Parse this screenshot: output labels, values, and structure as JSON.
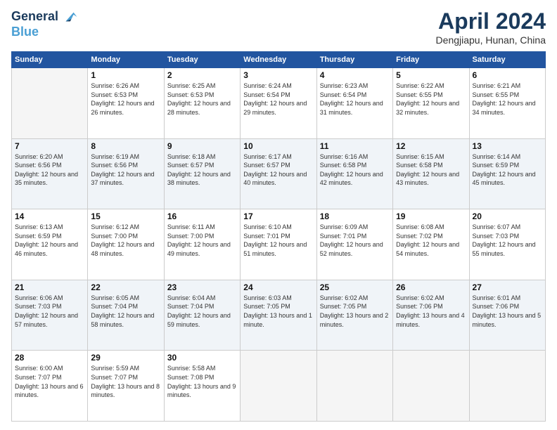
{
  "logo": {
    "line1": "General",
    "line2": "Blue"
  },
  "title": "April 2024",
  "location": "Dengjiapu, Hunan, China",
  "weekdays": [
    "Sunday",
    "Monday",
    "Tuesday",
    "Wednesday",
    "Thursday",
    "Friday",
    "Saturday"
  ],
  "weeks": [
    [
      {
        "day": null
      },
      {
        "day": 1,
        "sunrise": "6:26 AM",
        "sunset": "6:53 PM",
        "daylight": "12 hours and 26 minutes."
      },
      {
        "day": 2,
        "sunrise": "6:25 AM",
        "sunset": "6:53 PM",
        "daylight": "12 hours and 28 minutes."
      },
      {
        "day": 3,
        "sunrise": "6:24 AM",
        "sunset": "6:54 PM",
        "daylight": "12 hours and 29 minutes."
      },
      {
        "day": 4,
        "sunrise": "6:23 AM",
        "sunset": "6:54 PM",
        "daylight": "12 hours and 31 minutes."
      },
      {
        "day": 5,
        "sunrise": "6:22 AM",
        "sunset": "6:55 PM",
        "daylight": "12 hours and 32 minutes."
      },
      {
        "day": 6,
        "sunrise": "6:21 AM",
        "sunset": "6:55 PM",
        "daylight": "12 hours and 34 minutes."
      }
    ],
    [
      {
        "day": 7,
        "sunrise": "6:20 AM",
        "sunset": "6:56 PM",
        "daylight": "12 hours and 35 minutes."
      },
      {
        "day": 8,
        "sunrise": "6:19 AM",
        "sunset": "6:56 PM",
        "daylight": "12 hours and 37 minutes."
      },
      {
        "day": 9,
        "sunrise": "6:18 AM",
        "sunset": "6:57 PM",
        "daylight": "12 hours and 38 minutes."
      },
      {
        "day": 10,
        "sunrise": "6:17 AM",
        "sunset": "6:57 PM",
        "daylight": "12 hours and 40 minutes."
      },
      {
        "day": 11,
        "sunrise": "6:16 AM",
        "sunset": "6:58 PM",
        "daylight": "12 hours and 42 minutes."
      },
      {
        "day": 12,
        "sunrise": "6:15 AM",
        "sunset": "6:58 PM",
        "daylight": "12 hours and 43 minutes."
      },
      {
        "day": 13,
        "sunrise": "6:14 AM",
        "sunset": "6:59 PM",
        "daylight": "12 hours and 45 minutes."
      }
    ],
    [
      {
        "day": 14,
        "sunrise": "6:13 AM",
        "sunset": "6:59 PM",
        "daylight": "12 hours and 46 minutes."
      },
      {
        "day": 15,
        "sunrise": "6:12 AM",
        "sunset": "7:00 PM",
        "daylight": "12 hours and 48 minutes."
      },
      {
        "day": 16,
        "sunrise": "6:11 AM",
        "sunset": "7:00 PM",
        "daylight": "12 hours and 49 minutes."
      },
      {
        "day": 17,
        "sunrise": "6:10 AM",
        "sunset": "7:01 PM",
        "daylight": "12 hours and 51 minutes."
      },
      {
        "day": 18,
        "sunrise": "6:09 AM",
        "sunset": "7:01 PM",
        "daylight": "12 hours and 52 minutes."
      },
      {
        "day": 19,
        "sunrise": "6:08 AM",
        "sunset": "7:02 PM",
        "daylight": "12 hours and 54 minutes."
      },
      {
        "day": 20,
        "sunrise": "6:07 AM",
        "sunset": "7:03 PM",
        "daylight": "12 hours and 55 minutes."
      }
    ],
    [
      {
        "day": 21,
        "sunrise": "6:06 AM",
        "sunset": "7:03 PM",
        "daylight": "12 hours and 57 minutes."
      },
      {
        "day": 22,
        "sunrise": "6:05 AM",
        "sunset": "7:04 PM",
        "daylight": "12 hours and 58 minutes."
      },
      {
        "day": 23,
        "sunrise": "6:04 AM",
        "sunset": "7:04 PM",
        "daylight": "12 hours and 59 minutes."
      },
      {
        "day": 24,
        "sunrise": "6:03 AM",
        "sunset": "7:05 PM",
        "daylight": "13 hours and 1 minute."
      },
      {
        "day": 25,
        "sunrise": "6:02 AM",
        "sunset": "7:05 PM",
        "daylight": "13 hours and 2 minutes."
      },
      {
        "day": 26,
        "sunrise": "6:02 AM",
        "sunset": "7:06 PM",
        "daylight": "13 hours and 4 minutes."
      },
      {
        "day": 27,
        "sunrise": "6:01 AM",
        "sunset": "7:06 PM",
        "daylight": "13 hours and 5 minutes."
      }
    ],
    [
      {
        "day": 28,
        "sunrise": "6:00 AM",
        "sunset": "7:07 PM",
        "daylight": "13 hours and 6 minutes."
      },
      {
        "day": 29,
        "sunrise": "5:59 AM",
        "sunset": "7:07 PM",
        "daylight": "13 hours and 8 minutes."
      },
      {
        "day": 30,
        "sunrise": "5:58 AM",
        "sunset": "7:08 PM",
        "daylight": "13 hours and 9 minutes."
      },
      {
        "day": null
      },
      {
        "day": null
      },
      {
        "day": null
      },
      {
        "day": null
      }
    ]
  ]
}
